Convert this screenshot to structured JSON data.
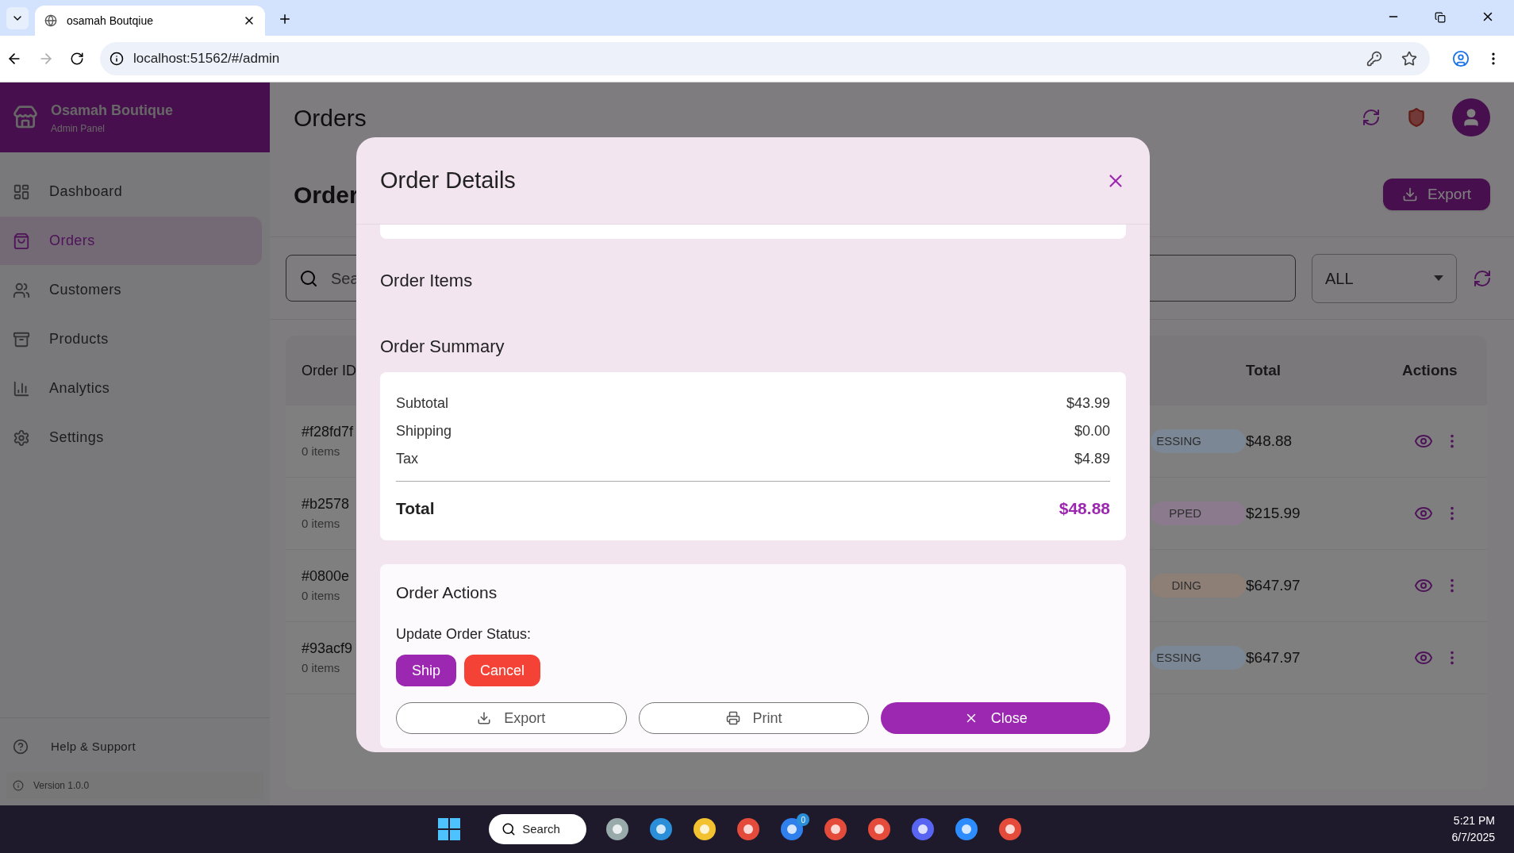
{
  "browser": {
    "tab_title": "osamah Boutqiue",
    "url": "localhost:51562/#/admin"
  },
  "sidebar": {
    "brand": "Osamah Boutique",
    "subtitle": "Admin Panel",
    "items": [
      {
        "label": "Dashboard",
        "selected": false
      },
      {
        "label": "Orders",
        "selected": true
      },
      {
        "label": "Customers",
        "selected": false
      },
      {
        "label": "Products",
        "selected": false
      },
      {
        "label": "Analytics",
        "selected": false
      },
      {
        "label": "Settings",
        "selected": false
      }
    ],
    "help": "Help & Support",
    "version": "Version 1.0.0"
  },
  "header": {
    "title": "Orders"
  },
  "section": {
    "title": "Order",
    "export_button": "Export"
  },
  "filters": {
    "search_placeholder": "Sea",
    "status": "ALL"
  },
  "table": {
    "columns": [
      "Order ID",
      "Total",
      "Actions"
    ],
    "rows": [
      {
        "id": "#f28fd7f",
        "items": "0 items",
        "status": "ESSING",
        "color": "#7b8794",
        "total": "$48.88"
      },
      {
        "id": "#b2578",
        "items": "0 items",
        "status": "PPED",
        "color": "#8b7a8e",
        "total": "$215.99"
      },
      {
        "id": "#0800e",
        "items": "0 items",
        "status": "DING",
        "color": "#8e7f76",
        "total": "$647.97"
      },
      {
        "id": "#93acf9",
        "items": "0 items",
        "status": "ESSING",
        "color": "#7b8794",
        "total": "$647.97"
      }
    ]
  },
  "modal": {
    "title": "Order Details",
    "items_heading": "Order Items",
    "summary_heading": "Order Summary",
    "summary": [
      {
        "label": "Subtotal",
        "value": "$43.99"
      },
      {
        "label": "Shipping",
        "value": "$0.00"
      },
      {
        "label": "Tax",
        "value": "$4.89"
      }
    ],
    "total_label": "Total",
    "total_value": "$48.88",
    "actions_heading": "Order Actions",
    "status_label": "Update Order Status:",
    "status_buttons": [
      {
        "label": "Ship",
        "kind": "primary"
      },
      {
        "label": "Cancel",
        "kind": "danger"
      }
    ],
    "footer_buttons": [
      {
        "label": "Export",
        "kind": "export"
      },
      {
        "label": "Print",
        "kind": "print"
      },
      {
        "label": "Close",
        "kind": "close"
      }
    ]
  },
  "taskbar": {
    "search": "Search",
    "badge": "0",
    "time": "5:21 PM",
    "date": "6/7/2025"
  }
}
